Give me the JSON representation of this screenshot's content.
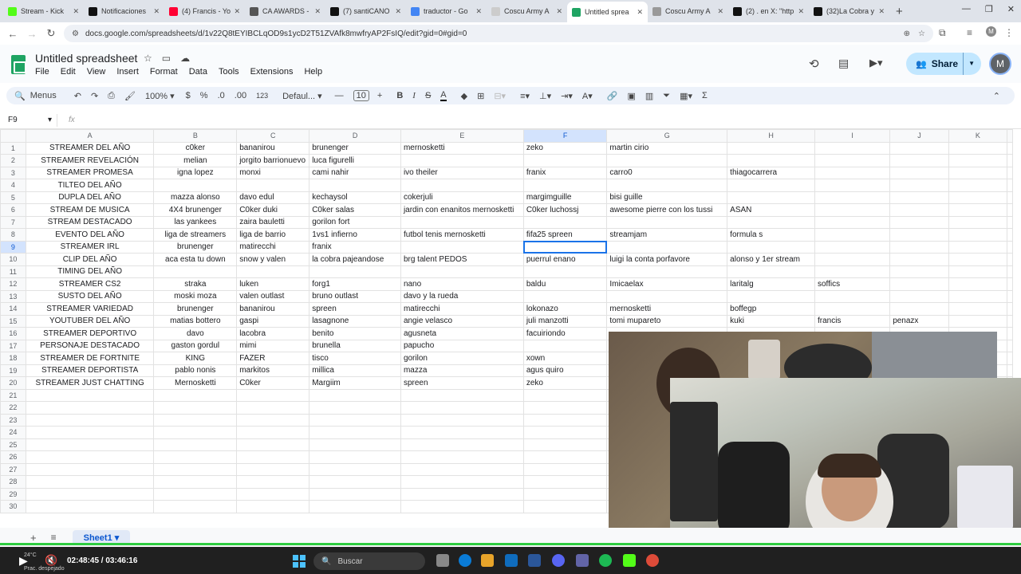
{
  "browser": {
    "tabs": [
      {
        "title": "Stream - Kick",
        "fav": "#53fc18"
      },
      {
        "title": "Notificaciones",
        "fav": "#111111"
      },
      {
        "title": "(4) Francis - Yo",
        "fav": "#ff0033"
      },
      {
        "title": "CA AWARDS -",
        "fav": "#555555"
      },
      {
        "title": "(7) santiCANO",
        "fav": "#111111"
      },
      {
        "title": "traductor - Go",
        "fav": "#4285f4"
      },
      {
        "title": "Coscu Army A",
        "fav": "#cccccc"
      },
      {
        "title": "Untitled sprea",
        "fav": "#1fa463"
      },
      {
        "title": "Coscu Army A",
        "fav": "#999999"
      },
      {
        "title": "(2) . en X: \"http",
        "fav": "#111111"
      },
      {
        "title": "(32)La Cobra y",
        "fav": "#111111"
      }
    ],
    "active_tab": 7,
    "url": "docs.google.com/spreadsheets/d/1v22Q8tEYIBCLqOD9s1ycD2T51ZVAfk8mwfryAP2FsIQ/edit?gid=0#gid=0"
  },
  "doc": {
    "title": "Untitled spreadsheet",
    "menu": [
      "File",
      "Edit",
      "View",
      "Insert",
      "Format",
      "Data",
      "Tools",
      "Extensions",
      "Help"
    ],
    "share_label": "Share",
    "avatar_letter": "M"
  },
  "toolbar": {
    "menus_label": "Menus",
    "zoom": "100%",
    "currency": "$",
    "percent": "%",
    "dec_less": ".0",
    "dec_more": ".00",
    "num_format": "123",
    "font": "Defaul...",
    "font_size": "10"
  },
  "formula_bar": {
    "cell_ref": "F9",
    "fx": "fx"
  },
  "sheet": {
    "columns": [
      "A",
      "B",
      "C",
      "D",
      "E",
      "F",
      "G",
      "H",
      "I",
      "J",
      "K"
    ],
    "selected_col": "F",
    "selected_row": 9,
    "rows": [
      [
        "STREAMER DEL AÑO",
        "c0ker",
        "bananirou",
        "brunenger",
        "mernosketti",
        "zeko",
        "martin cirio",
        "",
        "",
        "",
        ""
      ],
      [
        "STREAMER REVELACIÓN",
        "melian",
        "jorgito barrionuevo",
        "luca figurelli",
        "",
        "",
        "",
        "",
        "",
        "",
        ""
      ],
      [
        "STREAMER PROMESA",
        "igna lopez",
        "monxi",
        "cami nahir",
        "ivo theiler",
        "franix",
        "carro0",
        "thiagocarrera",
        "",
        "",
        ""
      ],
      [
        "TILTEO DEL AÑO",
        "",
        "",
        "",
        "",
        "",
        "",
        "",
        "",
        "",
        ""
      ],
      [
        "DUPLA DEL AÑO",
        "mazza alonso",
        "davo edul",
        "kechaysol",
        "cokerjuli",
        "margimguille",
        "bisi guille",
        "",
        "",
        "",
        ""
      ],
      [
        "STREAM DE MUSICA",
        "4X4 brunenger",
        "C0ker duki",
        "C0ker salas",
        "jardin con enanitos mernosketti",
        "C0ker luchossj",
        "awesome pierre con los tussi",
        "ASAN",
        "",
        "",
        ""
      ],
      [
        "STREAM DESTACADO",
        "las yankees",
        "zaira bauletti",
        "gorilon fort",
        "",
        "",
        "",
        "",
        "",
        "",
        ""
      ],
      [
        "EVENTO DEL AÑO",
        "liga de streamers",
        "liga de barrio",
        "1vs1 infierno",
        "futbol tenis mernosketti",
        "fifa25 spreen",
        "streamjam",
        "formula s",
        "",
        "",
        ""
      ],
      [
        "STREAMER IRL",
        "brunenger",
        "matirecchi",
        "franix",
        "",
        "",
        "",
        "",
        "",
        "",
        ""
      ],
      [
        "CLIP DEL AÑO",
        "aca esta tu down",
        "snow y valen",
        "la cobra pajeandose",
        "brg talent PEDOS",
        "puerrul enano",
        "luigi la conta porfavore",
        "alonso y 1er stream",
        "",
        "",
        ""
      ],
      [
        "TIMING DEL AÑO",
        "",
        "",
        "",
        "",
        "",
        "",
        "",
        "",
        "",
        ""
      ],
      [
        "STREAMER CS2",
        "straka",
        "luken",
        "forg1",
        "nano",
        "baldu",
        "Imicaelax",
        "laritalg",
        "soffics",
        "",
        ""
      ],
      [
        "SUSTO DEL AÑO",
        "moski moza",
        "valen outlast",
        "bruno outlast",
        "davo y la rueda",
        "",
        "",
        "",
        "",
        "",
        ""
      ],
      [
        "STREAMER VARIEDAD",
        "brunenger",
        "bananirou",
        "spreen",
        "matirecchi",
        "lokonazo",
        "mernosketti",
        "boffegp",
        "",
        "",
        ""
      ],
      [
        "YOUTUBER DEL AÑO",
        "matias bottero",
        "gaspi",
        "lasagnone",
        "angie velasco",
        "juli manzotti",
        "tomi mupareto",
        "kuki",
        "francis",
        "penazx",
        ""
      ],
      [
        "STREAMER DEPORTIVO",
        "davo",
        "lacobra",
        "benito",
        "agusneta",
        "facuiriondo",
        "",
        "",
        "",
        "",
        ""
      ],
      [
        "PERSONAJE DESTACADO",
        "gaston gordul",
        "mimi",
        "brunella",
        "papucho",
        "",
        "",
        "",
        "",
        "",
        ""
      ],
      [
        "STREAMER DE FORTNITE",
        "KING",
        "FAZER",
        "tisco",
        "gorilon",
        "xown",
        "",
        "",
        "",
        "",
        ""
      ],
      [
        "STREAMER DEPORTISTA",
        "pablo nonis",
        "markitos",
        "millica",
        "mazza",
        "agus quiro",
        "",
        "",
        "",
        "",
        ""
      ],
      [
        "STREAMER JUST CHATTING",
        "Mernosketti",
        "C0ker",
        "Margiim",
        "spreen",
        "zeko",
        "",
        "",
        "",
        "",
        ""
      ],
      [
        "",
        "",
        "",
        "",
        "",
        "",
        "",
        "",
        "",
        "",
        ""
      ],
      [
        "",
        "",
        "",
        "",
        "",
        "",
        "",
        "",
        "",
        "",
        ""
      ],
      [
        "",
        "",
        "",
        "",
        "",
        "",
        "",
        "",
        "",
        "",
        ""
      ],
      [
        "",
        "",
        "",
        "",
        "",
        "",
        "",
        "",
        "",
        "",
        ""
      ],
      [
        "",
        "",
        "",
        "",
        "",
        "",
        "",
        "",
        "",
        "",
        ""
      ],
      [
        "",
        "",
        "",
        "",
        "",
        "",
        "",
        "",
        "",
        "",
        ""
      ],
      [
        "",
        "",
        "",
        "",
        "",
        "",
        "",
        "",
        "",
        "",
        ""
      ],
      [
        "",
        "",
        "",
        "",
        "",
        "",
        "",
        "",
        "",
        "",
        ""
      ],
      [
        "",
        "",
        "",
        "",
        "",
        "",
        "",
        "",
        "",
        "",
        ""
      ],
      [
        "",
        "",
        "",
        "",
        "",
        "",
        "",
        "",
        "",
        "",
        ""
      ]
    ],
    "sheet_tab": "Sheet1"
  },
  "taskbar": {
    "weather_temp": "24°C",
    "weather_text": "Prac. despejado",
    "video_time": "02:48:45 / 03:46:16",
    "search_placeholder": "Buscar"
  },
  "colors": {
    "accent": "#1a73e8",
    "share_bg": "#c2e7ff",
    "progress": "#2ecc40"
  }
}
